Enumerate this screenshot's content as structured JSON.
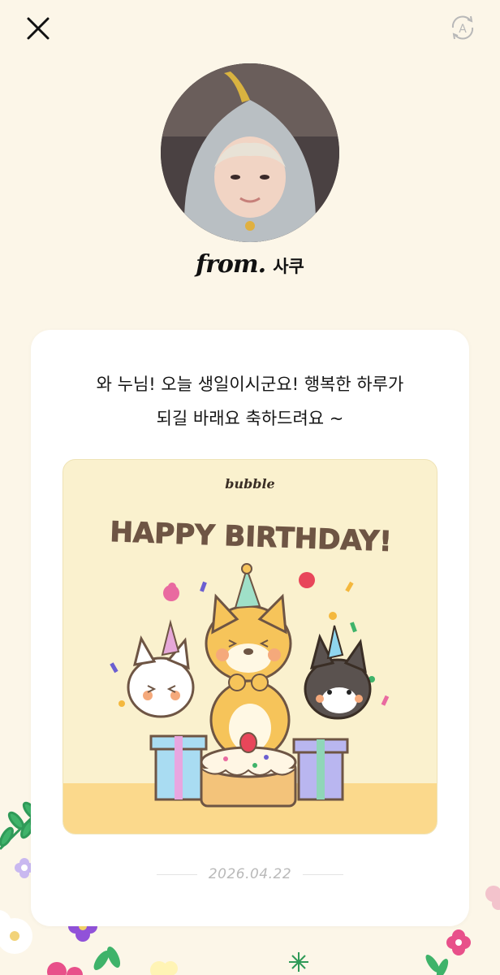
{
  "header": {
    "close_icon": "close-icon",
    "translate_icon": "auto-translate-icon"
  },
  "sender": {
    "from_word": "from.",
    "name": "사쿠"
  },
  "letter": {
    "lines": [
      "와 누님! 오늘 생일이시군요! 행복한 하루가",
      "되길 바래요 축하드려요 ~"
    ],
    "card_image": {
      "brand": "bubble",
      "headline": "HAPPY BIRTHDAY!"
    },
    "date": "2026.04.22"
  },
  "colors": {
    "background": "#FCF6E8",
    "card": "#FFFFFF",
    "art_background": "#FAF1CE",
    "headline": "#6E5544",
    "date": "#B9B9B9"
  }
}
